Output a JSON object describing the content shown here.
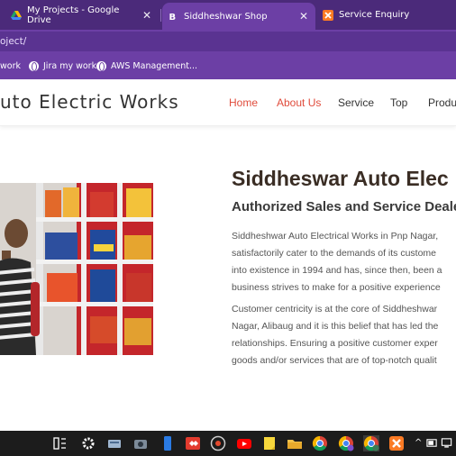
{
  "browser": {
    "tabs": [
      {
        "title": "My Projects - Google Drive",
        "icon": "google-drive-icon",
        "active": false
      },
      {
        "title": "Siddheshwar Shop",
        "icon": "bootstrap-icon",
        "active": true
      },
      {
        "title": "Service Enquiry",
        "icon": "xampp-icon",
        "active": false
      }
    ],
    "url": "oject/",
    "bookmarks": [
      {
        "label": "work",
        "icon": "globe-icon"
      },
      {
        "label": "Jira my work",
        "icon": "globe-icon"
      },
      {
        "label": "AWS Management...",
        "icon": "globe-icon"
      }
    ],
    "close_glyph": "✕"
  },
  "site": {
    "brand": "uto Electric Works",
    "nav": [
      {
        "label": "Home",
        "color": "#e04c3c"
      },
      {
        "label": "About Us",
        "color": "#e04c3c"
      },
      {
        "label": "Service",
        "color": "#333333"
      },
      {
        "label": "Top",
        "color": "#333333"
      },
      {
        "label": "Produ",
        "color": "#333333"
      }
    ]
  },
  "about": {
    "heading": "Siddheswar Auto Elec",
    "subheading": "Authorized Sales and Service Dealer o",
    "paragraph1": [
      "Siddheshwar Auto Electrical Works in Pnp Nagar,",
      "satisfactorily cater to the demands of its custome",
      "into existence in 1994 and has, since then, been a",
      "business strives to make for a positive experience"
    ],
    "paragraph2": [
      "Customer centricity is at the core of Siddheshwar",
      "Nagar, Alibaug and it is this belief that has led the",
      "relationships. Ensuring a positive customer exper",
      "goods and/or services that are of top-notch qualit"
    ]
  },
  "taskbar": {
    "apps": [
      "task-view-icon",
      "settings-icon",
      "network-drive-icon",
      "camera-icon",
      "phone-link-icon",
      "anydesk-icon",
      "media-player-icon",
      "youtube-icon",
      "sticky-notes-icon",
      "file-explorer-icon",
      "chrome-icon",
      "chrome-profile-icon",
      "chrome-active-icon",
      "xampp-icon"
    ],
    "tray_chevron": "^"
  },
  "colors": {
    "tab_bar": "#4b2a7a",
    "toolbar": "#6c3fa5",
    "accent_red": "#e04c3c",
    "heading_brown": "#3a2d24"
  }
}
